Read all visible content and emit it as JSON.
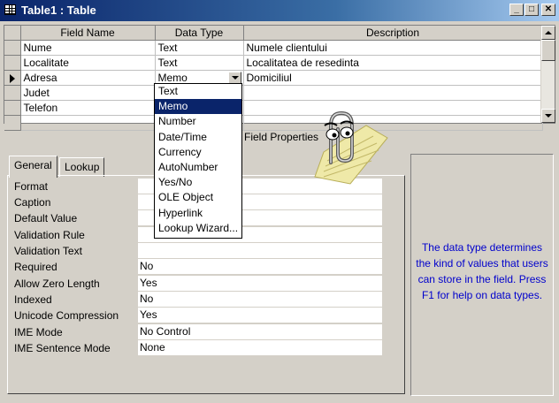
{
  "window": {
    "title": "Table1 : Table"
  },
  "grid": {
    "headers": [
      "Field Name",
      "Data Type",
      "Description"
    ],
    "rows": [
      {
        "field": "Nume",
        "type": "Text",
        "desc": "Numele clientului"
      },
      {
        "field": "Localitate",
        "type": "Text",
        "desc": "Localitatea de resedinta"
      },
      {
        "field": "Adresa",
        "type": "Memo",
        "desc": "Domiciliul"
      },
      {
        "field": "Judet",
        "type": "",
        "desc": ""
      },
      {
        "field": "Telefon",
        "type": "",
        "desc": ""
      },
      {
        "field": "",
        "type": "",
        "desc": ""
      }
    ]
  },
  "dropdown": {
    "options": [
      "Text",
      "Memo",
      "Number",
      "Date/Time",
      "Currency",
      "AutoNumber",
      "Yes/No",
      "OLE Object",
      "Hyperlink",
      "Lookup Wizard..."
    ],
    "selected": "Memo"
  },
  "field_properties_label": "Field Properties",
  "tabs": {
    "general": "General",
    "lookup": "Lookup"
  },
  "properties": [
    {
      "label": "Format",
      "value": ""
    },
    {
      "label": "Caption",
      "value": ""
    },
    {
      "label": "Default Value",
      "value": ""
    },
    {
      "label": "Validation Rule",
      "value": ""
    },
    {
      "label": "Validation Text",
      "value": ""
    },
    {
      "label": "Required",
      "value": "No"
    },
    {
      "label": "Allow Zero Length",
      "value": "Yes"
    },
    {
      "label": "Indexed",
      "value": "No"
    },
    {
      "label": "Unicode Compression",
      "value": "Yes"
    },
    {
      "label": "IME Mode",
      "value": "No Control"
    },
    {
      "label": "IME Sentence Mode",
      "value": "None"
    }
  ],
  "help_text": "The data type determines the kind of values that users can store in the field. Press F1 for help on data types.",
  "colors": {
    "title_start": "#0a246a",
    "title_end": "#a6caf0",
    "selection": "#0a246a",
    "help_text": "#0000cc",
    "face": "#d4d0c8"
  }
}
